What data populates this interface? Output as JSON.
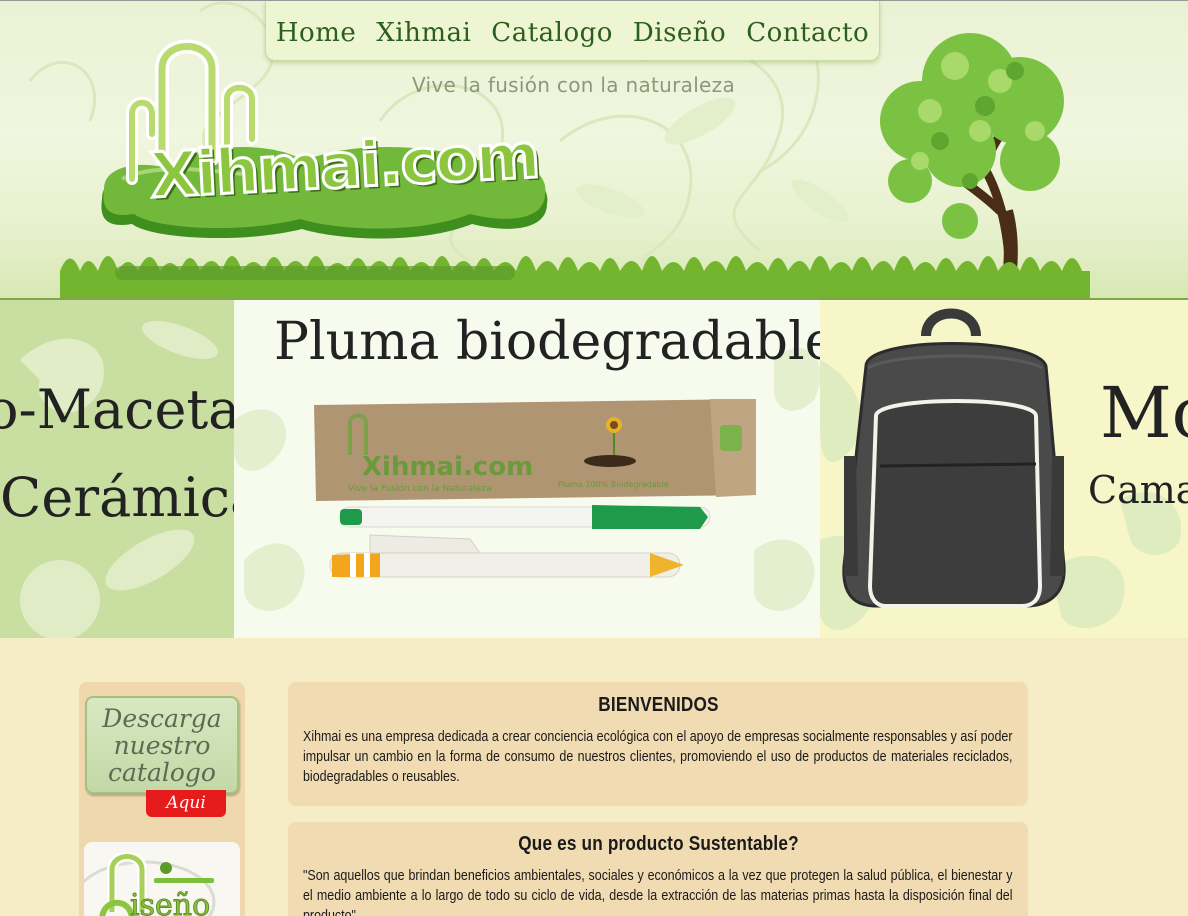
{
  "header": {
    "nav": [
      "Home",
      "Xihmai",
      "Catalogo",
      "Diseño",
      "Contacto"
    ],
    "tagline": "Vive la fusión con la naturaleza",
    "logo_text": "Xihmai.com"
  },
  "banner": {
    "left_panel": {
      "line1": "o-Maceta",
      "line2": "Cerámica"
    },
    "center_panel": {
      "title": "Pluma biodegradable",
      "package_brand": "Xihmai.com",
      "package_tagline": "Vive la Fusión con la Naturaleza",
      "package_note": "Pluma 100% Biodegradable"
    },
    "right_panel": {
      "line1": "Mo",
      "line2": "Cama"
    }
  },
  "sidebar": {
    "download": {
      "line1": "Descarga",
      "line2": "nuestro",
      "line3": "catalogo"
    },
    "aqui": "Aqui",
    "diseno_word": "iseño"
  },
  "main": {
    "welcome": {
      "title": "BIENVENIDOS",
      "body": "Xihmai es una empresa dedicada a crear conciencia ecológica con el apoyo de empresas socialmente responsables y así poder impulsar un cambio en la forma de consumo de nuestros clientes, promoviendo el uso de productos de materiales reciclados, biodegradables o reusables."
    },
    "sustainable": {
      "title": "Que es un producto Sustentable?",
      "body": "\"Son aquellos que brindan beneficios ambientales, sociales y económicos a la vez que protegen la salud pública, el bienestar y el medio ambiente a lo largo de todo su ciclo de vida, desde la extracción de las materias primas hasta la disposición final del producto\""
    }
  },
  "colors": {
    "nav_text": "#2c5e1e",
    "logo_green": "#8cc63e",
    "header_line": "#7ea64a",
    "content_box": "#f1dbb3",
    "page_bg": "#f6ecc6",
    "aqui_red": "#e61b1b"
  }
}
